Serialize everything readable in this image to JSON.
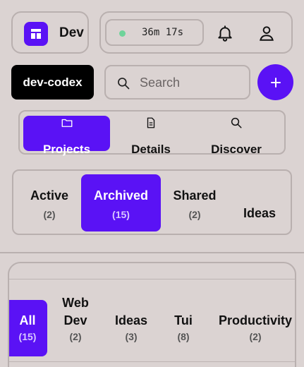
{
  "header": {
    "brand_name": "Dev Codex",
    "timer": "36m 17s",
    "icons": [
      "layout-icon",
      "bell-icon",
      "user-icon"
    ]
  },
  "toolbar": {
    "workspace_label": "dev-codex",
    "search_placeholder": "Search",
    "add_icon": "plus-icon"
  },
  "tabs": [
    {
      "label": "Projects",
      "icon": "folder-icon",
      "active": true
    },
    {
      "label": "Details",
      "icon": "document-icon",
      "active": false
    },
    {
      "label": "Discover",
      "icon": "search-icon",
      "active": false
    }
  ],
  "filters": [
    {
      "label": "Active",
      "count": "(2)",
      "active": false
    },
    {
      "label": "Archived",
      "count": "(15)",
      "active": true
    },
    {
      "label": "Shared",
      "count": "(2)",
      "active": false
    },
    {
      "label": "Ideas",
      "count": "",
      "active": false
    }
  ],
  "categories": [
    {
      "label": "All",
      "count": "(15)",
      "active": true
    },
    {
      "label": "Web Dev",
      "count": "(2)",
      "active": false
    },
    {
      "label": "Ideas",
      "count": "(3)",
      "active": false
    },
    {
      "label": "Tui",
      "count": "(8)",
      "active": false
    },
    {
      "label": "Productivity",
      "count": "(2)",
      "active": false
    }
  ],
  "colors": {
    "accent": "#5a12f5",
    "background": "#dbd3d2",
    "border": "#b9b0af",
    "status_dot": "#6fd39a"
  }
}
